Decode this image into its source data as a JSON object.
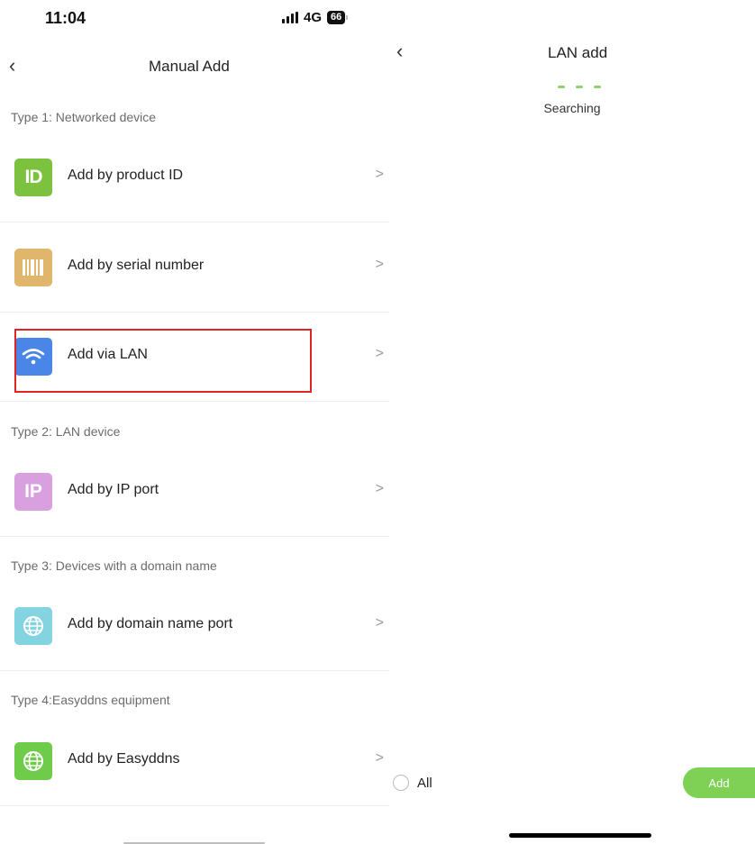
{
  "status": {
    "time": "11:04",
    "network": "4G",
    "battery": "66"
  },
  "left": {
    "title": "Manual Add",
    "sections": {
      "type1": "Type 1: Networked device",
      "type2": "Type 2: LAN device",
      "type3": "Type 3: Devices with a domain name",
      "type4": "Type 4:Easyddns equipment"
    },
    "items": {
      "product_id": {
        "label": "Add by product ID",
        "icon": "id-icon",
        "color": "#7dc23f",
        "glyph": "ID"
      },
      "serial": {
        "label": "Add by serial number",
        "icon": "barcode-icon",
        "color": "#e0b56c"
      },
      "lan": {
        "label": "Add via LAN",
        "icon": "wifi-icon",
        "color": "#4a86e8"
      },
      "ip_port": {
        "label": "Add by IP port",
        "icon": "ip-icon",
        "color": "#d9a0e0",
        "glyph": "IP"
      },
      "domain": {
        "label": "Add by domain name port",
        "icon": "globe-icon",
        "color": "#83d3e0"
      },
      "easyddns": {
        "label": "Add by Easyddns",
        "icon": "globe-icon",
        "color": "#6fcb4a"
      }
    },
    "chevron": ">"
  },
  "right": {
    "title": "LAN add",
    "status_text": "Searching",
    "select_all_label": "All",
    "add_label": "Add"
  },
  "colors": {
    "accent": "#7ed154",
    "highlight": "#e02424"
  }
}
